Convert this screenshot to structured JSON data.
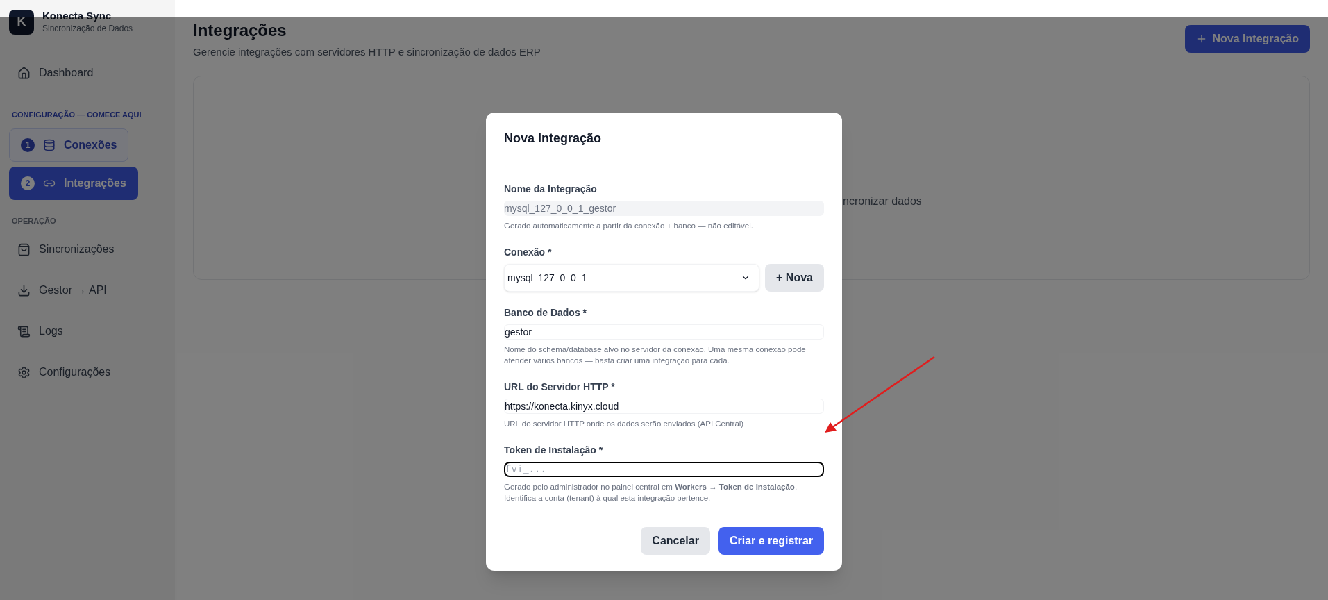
{
  "app": {
    "logo_letter": "K",
    "name": "Konecta Sync",
    "subtitle": "Sincronização de Dados"
  },
  "sidebar": {
    "groups": [
      {
        "items": [
          {
            "label": "Dashboard",
            "kind": "link",
            "selected": false
          }
        ]
      },
      {
        "title": "CONFIGURAÇÃO — COMECE AQUI",
        "highlighted": true,
        "items": [
          {
            "label": "Conexões",
            "kind": "step",
            "step": "1",
            "selected": false
          },
          {
            "label": "Integrações",
            "kind": "step",
            "step": "2",
            "selected": true
          }
        ]
      },
      {
        "title": "OPERAÇÃO",
        "highlighted": false,
        "items": [
          {
            "label": "Sincronizações",
            "kind": "link",
            "selected": false
          },
          {
            "label": "Gestor → API",
            "kind": "link",
            "selected": false
          },
          {
            "label": "Logs",
            "kind": "link",
            "selected": false
          },
          {
            "label": "Configurações",
            "kind": "link",
            "selected": false
          }
        ]
      }
    ]
  },
  "page": {
    "title": "Integrações",
    "subtitle": "Gerencie integrações com servidores HTTP e sincronização de dados ERP",
    "new_button": "Nova Integração",
    "empty_text": "ncronizar dados"
  },
  "modal": {
    "title": "Nova Integração",
    "fields": [
      {
        "kind": "readonly",
        "label": "Nome da Integração",
        "value": "mysql_127_0_0_1_gestor",
        "help": "Gerado automaticamente a partir da conexão + banco — não editável.",
        "focused": false
      },
      {
        "kind": "select",
        "label": "Conexão *",
        "value": "mysql_127_0_0_1",
        "side_button": "+ Nova",
        "focused": false
      },
      {
        "kind": "text",
        "label": "Banco de Dados *",
        "value": "gestor",
        "help": "Nome do schema/database alvo no servidor da conexão. Uma mesma conexão pode atender vários bancos — basta criar uma integração para cada.",
        "focused": false
      },
      {
        "kind": "text",
        "label": "URL do Servidor HTTP *",
        "value": "https://konecta.kinyx.cloud",
        "help": "URL do servidor HTTP onde os dados serão enviados (API Central)",
        "focused": false
      },
      {
        "kind": "token",
        "label": "Token de Instalação *",
        "placeholder": "fvi_...",
        "help": "Gerado pelo administrador no painel central em **Workers → Token de Instalação**. Identifica a conta (tenant) à qual esta integração pertence.",
        "focused": true
      }
    ],
    "buttons": [
      {
        "label": "Cancelar",
        "kind": "secondary"
      },
      {
        "label": "Criar e registrar",
        "kind": "primary"
      }
    ]
  }
}
